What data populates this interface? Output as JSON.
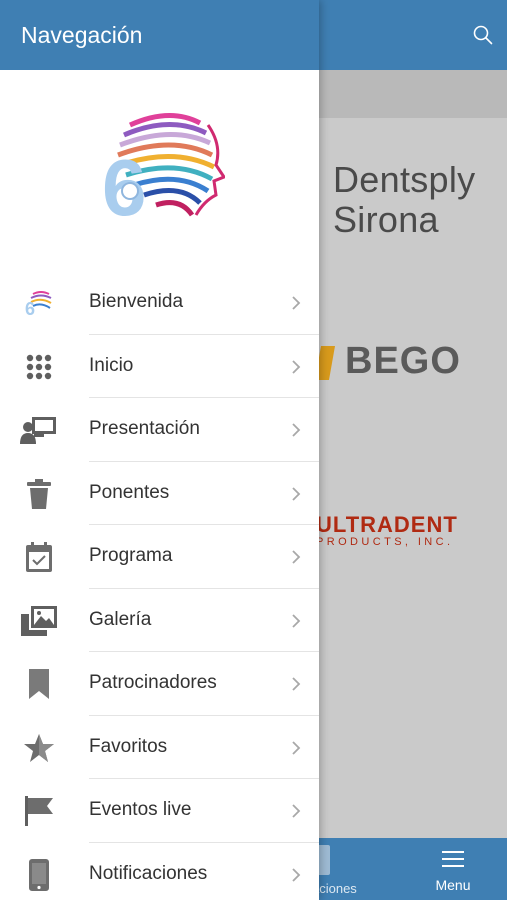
{
  "drawer": {
    "title": "Navegación",
    "items": [
      {
        "label": "Bienvenida",
        "icon": "event-logo-icon"
      },
      {
        "label": "Inicio",
        "icon": "grid-icon"
      },
      {
        "label": "Presentación",
        "icon": "presentation-icon"
      },
      {
        "label": "Ponentes",
        "icon": "trash-icon"
      },
      {
        "label": "Programa",
        "icon": "calendar-icon"
      },
      {
        "label": "Galería",
        "icon": "gallery-icon"
      },
      {
        "label": "Patrocinadores",
        "icon": "bookmark-icon"
      },
      {
        "label": "Favoritos",
        "icon": "star-icon"
      },
      {
        "label": "Eventos live",
        "icon": "flag-icon"
      },
      {
        "label": "Notificaciones",
        "icon": "phone-icon"
      }
    ]
  },
  "background": {
    "sponsors": [
      {
        "name_line1": "Dentsply",
        "name_line2": "Sirona"
      },
      {
        "name": "BEGO"
      },
      {
        "name": "ULTRADENT",
        "subtitle": "PRODUCTS, INC."
      }
    ],
    "tabbar": {
      "partial_label": "aciones",
      "menu_label": "Menu"
    }
  },
  "colors": {
    "header": "#3f7fb3",
    "drawer_bg": "#ffffff",
    "overlay": "#c9c9c9",
    "text": "#333333",
    "icon_gray": "#6d6d6d"
  }
}
